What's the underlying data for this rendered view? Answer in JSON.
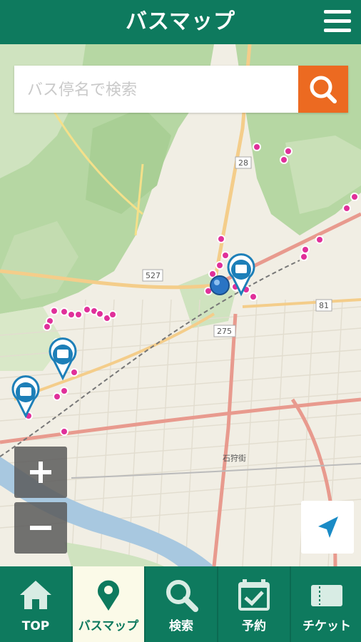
{
  "header": {
    "title": "バスマップ"
  },
  "search": {
    "placeholder": "バス停名で検索"
  },
  "map": {
    "road_labels": [
      "28",
      "527",
      "81",
      "275",
      "石狩街"
    ],
    "zoom_in_label": "+",
    "zoom_out_label": "−"
  },
  "nav": [
    {
      "label": "TOP",
      "icon": "home-icon"
    },
    {
      "label": "バスマップ",
      "icon": "map-pin-icon"
    },
    {
      "label": "検索",
      "icon": "search-icon"
    },
    {
      "label": "予約",
      "icon": "calendar-icon"
    },
    {
      "label": "チケット",
      "icon": "ticket-icon"
    }
  ],
  "colors": {
    "brand": "#0e7a5e",
    "search_button": "#ec6a21",
    "stop_marker": "#e0309a",
    "active_tab_bg": "#fbfae8"
  }
}
